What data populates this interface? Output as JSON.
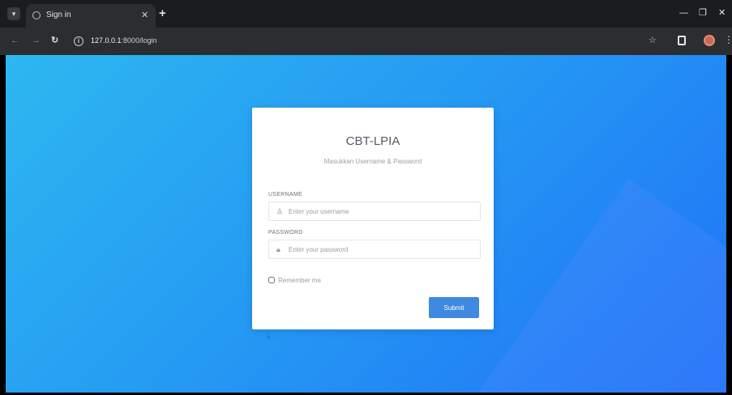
{
  "browser": {
    "tab_title": "Sign in",
    "new_tab": "+",
    "tab_close": "✕",
    "url_host": "127.0.0.1",
    "url_path": ":8000/login",
    "window_controls": {
      "minimize": "—",
      "maximize": "❐",
      "close": "✕"
    }
  },
  "login": {
    "title": "CBT-LPIA",
    "subtitle": "Masukkan Username & Password",
    "username_label": "USERNAME",
    "username_placeholder": "Enter your username",
    "password_label": "PASSWORD",
    "password_placeholder": "Enter your password",
    "remember_label": "Remember me",
    "submit_label": "Submit"
  },
  "colors": {
    "accent": "#3f8ae0",
    "background_gradient_start": "#2db7f0",
    "background_gradient_end": "#1f72f7"
  },
  "icons": {
    "username": "user-icon",
    "password": "lock-icon"
  }
}
